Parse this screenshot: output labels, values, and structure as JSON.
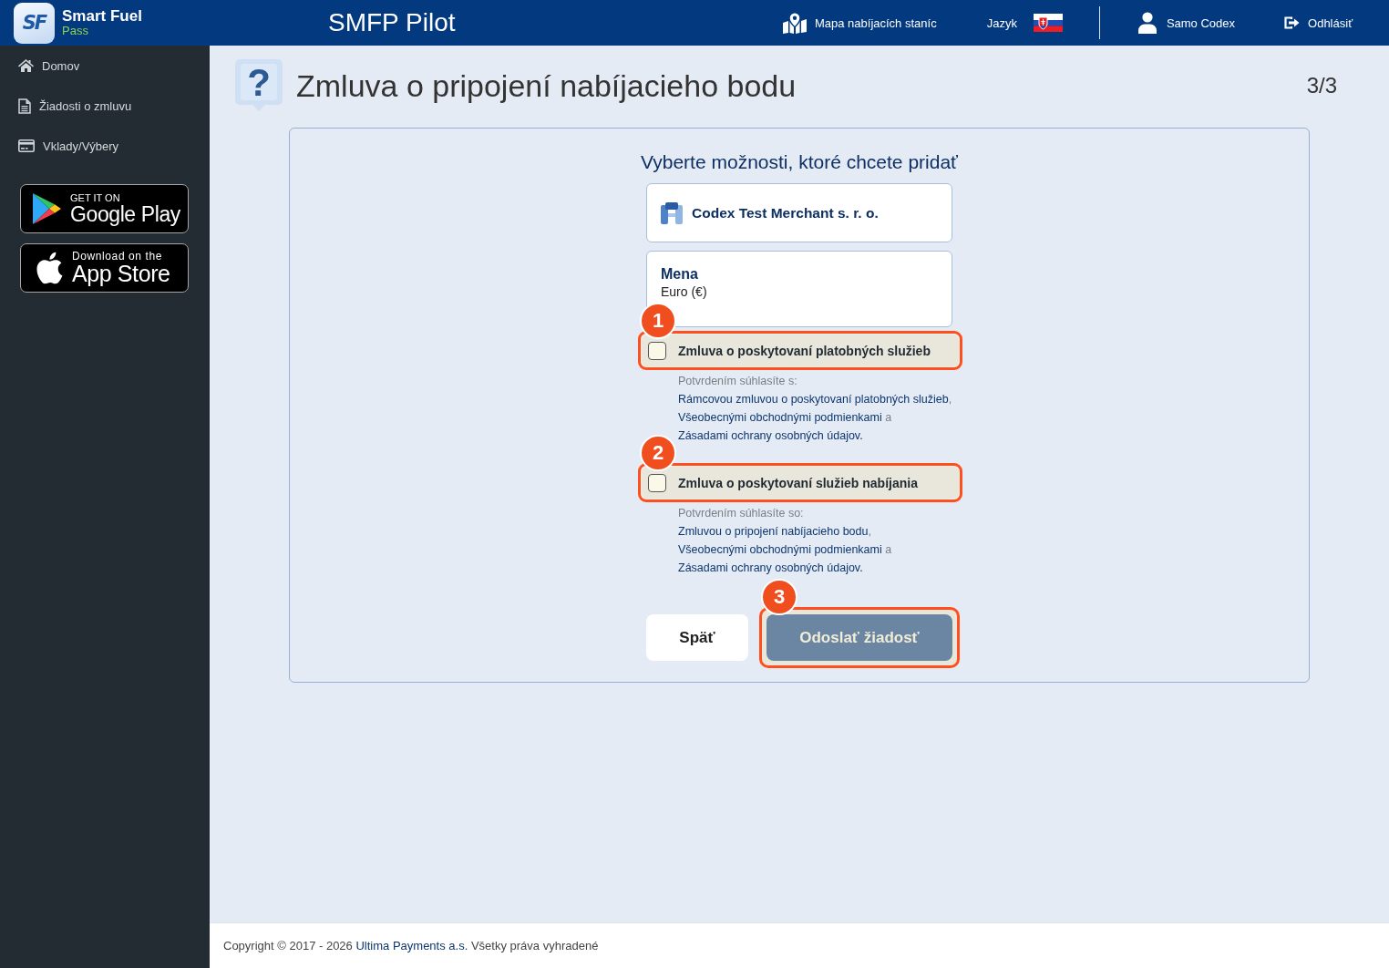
{
  "header": {
    "logo": {
      "mark": "SF",
      "name": "Smart Fuel",
      "tagline": "Pass"
    },
    "title": "SMFP Pilot",
    "nav": [
      {
        "kind": "map",
        "label": "Mapa nabíjacích staníc"
      },
      {
        "kind": "language",
        "label": "Jazyk"
      },
      {
        "kind": "user",
        "label": "Samo Codex"
      },
      {
        "kind": "logout",
        "label": "Odhlásiť"
      }
    ]
  },
  "sidebar": {
    "items": [
      {
        "kind": "home",
        "label": "Domov",
        "selected": false
      },
      {
        "kind": "document",
        "label": "Žiadosti o zmluvu",
        "selected": false
      },
      {
        "kind": "card",
        "label": "Vklady/Výbery",
        "selected": false
      }
    ],
    "store_badges": [
      {
        "kind": "google_play",
        "caption": "GET IT ON",
        "name": "Google Play"
      },
      {
        "kind": "app_store",
        "caption": "Download on the",
        "name": "App Store"
      }
    ]
  },
  "page": {
    "icon_glyph": "?",
    "title": "Zmluva o pripojení nabíjacieho bodu",
    "step": "3/3"
  },
  "form": {
    "heading": "Vyberte možnosti, ktoré chcete pridať",
    "merchant": "Codex Test Merchant s. r. o.",
    "currency": {
      "label": "Mena",
      "value": "Euro (€)"
    },
    "options": [
      {
        "label": "Zmluva o poskytovaní platobných služieb",
        "checked": false,
        "callout": "1",
        "consent": [
          {
            "kind": "text",
            "text": "Potvrdením súhlasíte s: "
          },
          {
            "kind": "link",
            "text": "Rámcovou zmluvou o poskytovaní platobných služieb"
          },
          {
            "kind": "text",
            "text": ", "
          },
          {
            "kind": "link",
            "text": "Všeobecnými obchodnými podmienkami"
          },
          {
            "kind": "text",
            "text": " a "
          },
          {
            "kind": "link",
            "text": "Zásadami ochrany osobných údajov."
          }
        ]
      },
      {
        "label": "Zmluva o poskytovaní služieb nabíjania",
        "checked": false,
        "callout": "2",
        "consent": [
          {
            "kind": "text",
            "text": "Potvrdením súhlasíte so: "
          },
          {
            "kind": "link",
            "text": "Zmluvou o pripojení nabíjacieho bodu"
          },
          {
            "kind": "text",
            "text": ", "
          },
          {
            "kind": "link",
            "text": "Všeobecnými obchodnými podmienkami"
          },
          {
            "kind": "text",
            "text": " a "
          },
          {
            "kind": "link",
            "text": "Zásadami ochrany osobných údajov."
          }
        ]
      }
    ],
    "buttons": [
      {
        "kind": "secondary",
        "label": "Späť",
        "disabled": false
      },
      {
        "kind": "primary",
        "label": "Odoslať žiadosť",
        "disabled": true,
        "callout": "3"
      }
    ]
  },
  "footer": {
    "parts": [
      {
        "kind": "text",
        "text": "Copyright © 2017 - 2026 "
      },
      {
        "kind": "link",
        "text": "Ultima Payments a.s."
      },
      {
        "kind": "text",
        "text": " Všetky práva vyhradené"
      }
    ]
  }
}
